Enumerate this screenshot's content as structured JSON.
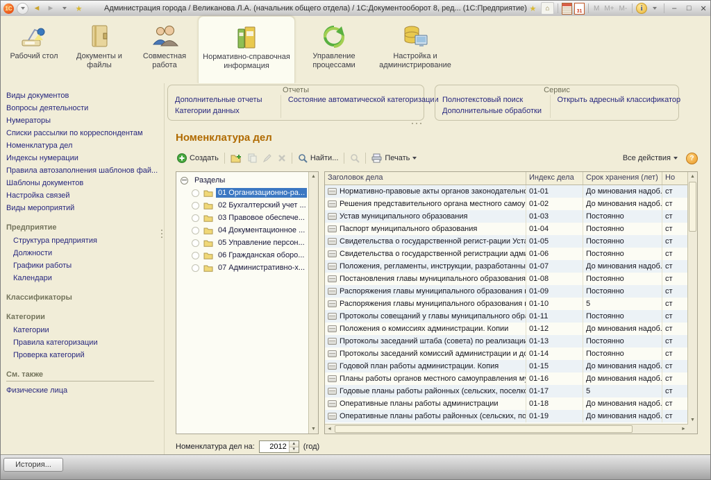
{
  "window": {
    "logo_text": "1С",
    "title": "Администрация города / Великанова Л.А. (начальник общего отдела) / 1С:Документооборот 8, ред...  (1С:Предприятие)",
    "memory": [
      "M",
      "M+",
      "M-"
    ],
    "calendar_day": "31"
  },
  "colors": {
    "selection": "#3b77c2",
    "form_title": "#b06a00",
    "link": "#26267e",
    "background": "#f1edd8"
  },
  "ribbon": {
    "tabs": [
      {
        "label": "Рабочий стол"
      },
      {
        "label": "Документы и файлы"
      },
      {
        "label": "Совместная работа"
      },
      {
        "label": "Нормативно-справочная информация",
        "active": true
      },
      {
        "label": "Управление процессами"
      },
      {
        "label": "Настройка и администрирование"
      }
    ]
  },
  "sidebar": {
    "groups": [
      {
        "header": "",
        "items": [
          "Виды документов",
          "Вопросы деятельности",
          "Нумераторы",
          "Списки рассылки по корреспондентам",
          "Номенклатура дел",
          "Индексы нумерации",
          "Правила автозаполнения шаблонов фай...",
          "Шаблоны документов",
          "Настройка связей",
          "Виды мероприятий"
        ]
      },
      {
        "header": "Предприятие",
        "items": [
          "Структура предприятия",
          "Должности",
          "Графики работы",
          "Календари"
        ]
      },
      {
        "header": "Классификаторы",
        "items": []
      },
      {
        "header": "Категории",
        "items": [
          "Категории",
          "Правила категоризации",
          "Проверка категорий"
        ]
      },
      {
        "header": "См. также",
        "items": [
          "Физические лица"
        ]
      }
    ]
  },
  "panels": {
    "reports": {
      "title": "Отчеты",
      "col1": [
        "Дополнительные отчеты",
        "Категории данных"
      ],
      "col2": [
        "Состояние автоматической категоризации"
      ]
    },
    "service": {
      "title": "Сервис",
      "col1": [
        "Полнотекстовый поиск",
        "Дополнительные обработки"
      ],
      "col2": [
        "Открыть адресный классификатор"
      ]
    }
  },
  "content": {
    "title": "Номенклатура дел",
    "toolbar": {
      "create": "Создать",
      "find": "Найти...",
      "print": "Печать",
      "all_actions": "Все действия",
      "help_label": "?"
    },
    "tree": {
      "root": "Разделы",
      "items": [
        {
          "label": "01 Организационно-ра...",
          "selected": true
        },
        {
          "label": "02 Бухгалтерский учет ...",
          "selected": false
        },
        {
          "label": "03 Правовое обеспече...",
          "selected": false
        },
        {
          "label": "04 Документационное ...",
          "selected": false
        },
        {
          "label": "05 Управление персон...",
          "selected": false
        },
        {
          "label": "06 Гражданская оборо...",
          "selected": false
        },
        {
          "label": "07 Административно-х...",
          "selected": false
        }
      ]
    },
    "table": {
      "columns": [
        "Заголовок дела",
        "Индекс дела",
        "Срок хранения (лет)",
        "Но"
      ],
      "rows": [
        {
          "title": "Нормативно-правовые акты органов законодательной...",
          "index": "01-01",
          "storage": "До минования надоб...",
          "extra": "ст"
        },
        {
          "title": "Решения представительного органа местного самоуп...",
          "index": "01-02",
          "storage": "До минования надоб...",
          "extra": "ст"
        },
        {
          "title": "Устав муниципального образования",
          "index": "01-03",
          "storage": "Постоянно",
          "extra": "ст"
        },
        {
          "title": "Паспорт муниципального образования",
          "index": "01-04",
          "storage": "Постоянно",
          "extra": "ст"
        },
        {
          "title": "Свидетельства о государственной регист-рации Устав...",
          "index": "01-05",
          "storage": "Постоянно",
          "extra": "ст"
        },
        {
          "title": "Свидетельства о государственной регистрации админ...",
          "index": "01-06",
          "storage": "Постоянно",
          "extra": "ст"
        },
        {
          "title": "Положения, регламенты, инструкции, разработанные ...",
          "index": "01-07",
          "storage": "До минования надоб...",
          "extra": "ст"
        },
        {
          "title": "Постановления главы муниципального образования",
          "index": "01-08",
          "storage": "Постоянно",
          "extra": "ст"
        },
        {
          "title": "Распоряжения главы муниципального образования по...",
          "index": "01-09",
          "storage": "Постоянно",
          "extra": "ст"
        },
        {
          "title": "Распоряжения главы муниципального образования по...",
          "index": "01-10",
          "storage": "5",
          "extra": "ст"
        },
        {
          "title": "Протоколы совещаний у главы муниципального образ...",
          "index": "01-11",
          "storage": "Постоянно",
          "extra": "ст"
        },
        {
          "title": "Положения о комиссиях администрации. Копии",
          "index": "01-12",
          "storage": "До минования надоб...",
          "extra": "ст"
        },
        {
          "title": "Протоколы заседаний штаба (совета) по реализации п...",
          "index": "01-13",
          "storage": "Постоянно",
          "extra": "ст"
        },
        {
          "title": "Протоколы заседаний комиссий администрации и док...",
          "index": "01-14",
          "storage": "Постоянно",
          "extra": "ст"
        },
        {
          "title": "Годовой план работы администрации. Копия",
          "index": "01-15",
          "storage": "До минования надоб...",
          "extra": "ст"
        },
        {
          "title": "Планы работы органов местного самоуправления мун...",
          "index": "01-16",
          "storage": "До минования надоб...",
          "extra": "ст"
        },
        {
          "title": "Годовые планы работы районных (сельских, поселков...",
          "index": "01-17",
          "storage": "5",
          "extra": "ст"
        },
        {
          "title": "Оперативные планы работы администрации",
          "index": "01-18",
          "storage": "До минования надоб...",
          "extra": "ст"
        },
        {
          "title": "Оперативные планы работы районных (сельских, посе...",
          "index": "01-19",
          "storage": "До минования надоб...",
          "extra": "ст"
        }
      ]
    },
    "footer": {
      "label": "Номенклатура дел на:",
      "year": "2012",
      "suffix": "(год)"
    }
  },
  "statusbar": {
    "history_label": "История..."
  }
}
